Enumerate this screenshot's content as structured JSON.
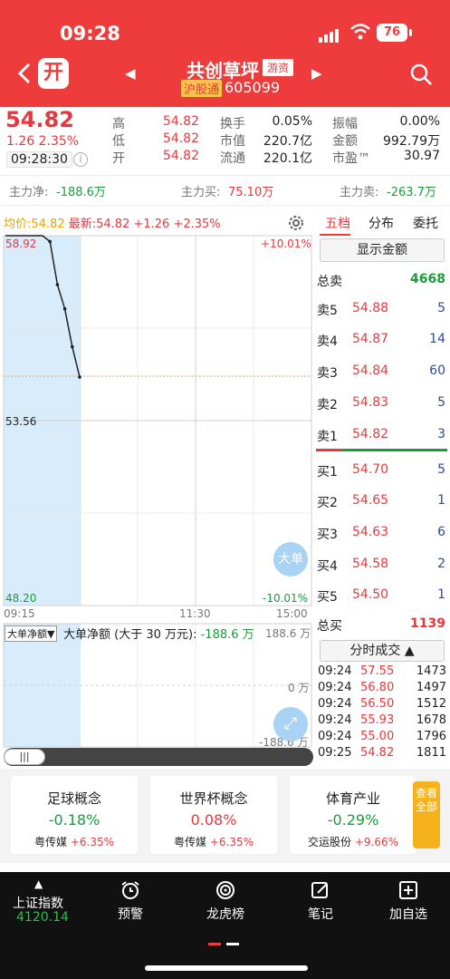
{
  "status_bar": {
    "time": "09:28",
    "battery": "76"
  },
  "header": {
    "open_badge": "开",
    "stock_name": "共创草坪",
    "tag": "游资",
    "market_tag": "沪股通",
    "stock_code": "605099"
  },
  "quote": {
    "price": "54.82",
    "change": "1.26  2.35%",
    "time": "09:28:30",
    "grid": [
      {
        "label": "高",
        "value": "54.82"
      },
      {
        "label": "低",
        "value": "54.82"
      },
      {
        "label": "开",
        "value": "54.82"
      },
      {
        "label": "换手",
        "value": "0.05%"
      },
      {
        "label": "市值",
        "value": "220.7亿"
      },
      {
        "label": "流通",
        "value": "220.1亿"
      },
      {
        "label": "振幅",
        "value": "0.00%"
      },
      {
        "label": "金额",
        "value": "992.79万"
      },
      {
        "label": "市盈™",
        "value": "30.97"
      }
    ]
  },
  "flows": {
    "main_net_label": "主力净:",
    "main_net": "-188.6万",
    "main_buy_label": "主力买:",
    "main_buy": "75.10万",
    "main_sell_label": "主力卖:",
    "main_sell": "-263.7万"
  },
  "chart": {
    "avg_label": "均价:54.82",
    "latest_label": "最新:54.82 +1.26 +2.35%",
    "y_top": "58.92",
    "y_mid": "53.56",
    "y_bottom": "48.20",
    "pct_top": "+10.01%",
    "pct_bottom": "-10.01%",
    "time_start": "09:15",
    "time_mid": "11:30",
    "time_end": "15:00",
    "big_order_btn": "大单",
    "sub_selector": "大单净额▼",
    "sub_title": "大单净额 (大于 30 万元):",
    "sub_value": "-188.6 万",
    "sub_top": "188.6 万",
    "sub_zero": "0 万",
    "sub_bottom": "-188.6 万"
  },
  "chart_data": {
    "type": "line",
    "title": "",
    "ylim": [
      48.2,
      58.92
    ],
    "x": [
      "09:15",
      "09:16",
      "09:17",
      "09:18",
      "09:19",
      "09:20",
      "09:21",
      "09:22",
      "09:23",
      "09:24",
      "09:25"
    ],
    "series": [
      {
        "values": [
          58.92,
          58.92,
          58.92,
          58.92,
          58.92,
          58.92,
          58.75,
          57.5,
          56.8,
          55.7,
          54.82
        ]
      }
    ]
  },
  "right_panel": {
    "tabs": [
      "五档",
      "分布",
      "委托"
    ],
    "show_amount": "显示金额",
    "total_sell_label": "总卖",
    "total_sell": "4668",
    "asks": [
      {
        "label": "卖5",
        "price": "54.88",
        "vol": "5"
      },
      {
        "label": "卖4",
        "price": "54.87",
        "vol": "14"
      },
      {
        "label": "卖3",
        "price": "54.84",
        "vol": "60"
      },
      {
        "label": "卖2",
        "price": "54.83",
        "vol": "5"
      },
      {
        "label": "卖1",
        "price": "54.82",
        "vol": "3"
      }
    ],
    "bids": [
      {
        "label": "买1",
        "price": "54.70",
        "vol": "5"
      },
      {
        "label": "买2",
        "price": "54.65",
        "vol": "1"
      },
      {
        "label": "买3",
        "price": "54.63",
        "vol": "6"
      },
      {
        "label": "买4",
        "price": "54.58",
        "vol": "2"
      },
      {
        "label": "买5",
        "price": "54.50",
        "vol": "1"
      }
    ],
    "total_buy_label": "总买",
    "total_buy": "1139",
    "ticks_btn": "分时成交 ▲",
    "ticks": [
      {
        "time": "09:24",
        "price": "57.55",
        "vol": "1473"
      },
      {
        "time": "09:24",
        "price": "56.80",
        "vol": "1497"
      },
      {
        "time": "09:24",
        "price": "56.50",
        "vol": "1512"
      },
      {
        "time": "09:24",
        "price": "55.93",
        "vol": "1678"
      },
      {
        "time": "09:24",
        "price": "55.00",
        "vol": "1796"
      },
      {
        "time": "09:25",
        "price": "54.82",
        "vol": "1811"
      }
    ]
  },
  "concepts": [
    {
      "title": "足球概念",
      "pct": "-0.18%",
      "lead": "粤传媒",
      "lead_pct": "+6.35%",
      "dir": "down"
    },
    {
      "title": "世界杯概念",
      "pct": "0.08%",
      "lead": "粤传媒",
      "lead_pct": "+6.35%",
      "dir": "up"
    },
    {
      "title": "体育产业",
      "pct": "-0.29%",
      "lead": "交运股份",
      "lead_pct": "+9.66%",
      "dir": "down"
    }
  ],
  "see_all": "查看全部",
  "bottom_nav": {
    "index_label": "上证指数",
    "index_value": "4120.14",
    "items": [
      "预警",
      "龙虎榜",
      "笔记",
      "加自选"
    ]
  },
  "colors": {
    "up": "#e8383d",
    "down": "#1a9c3a",
    "header": "#ee3b3b"
  }
}
